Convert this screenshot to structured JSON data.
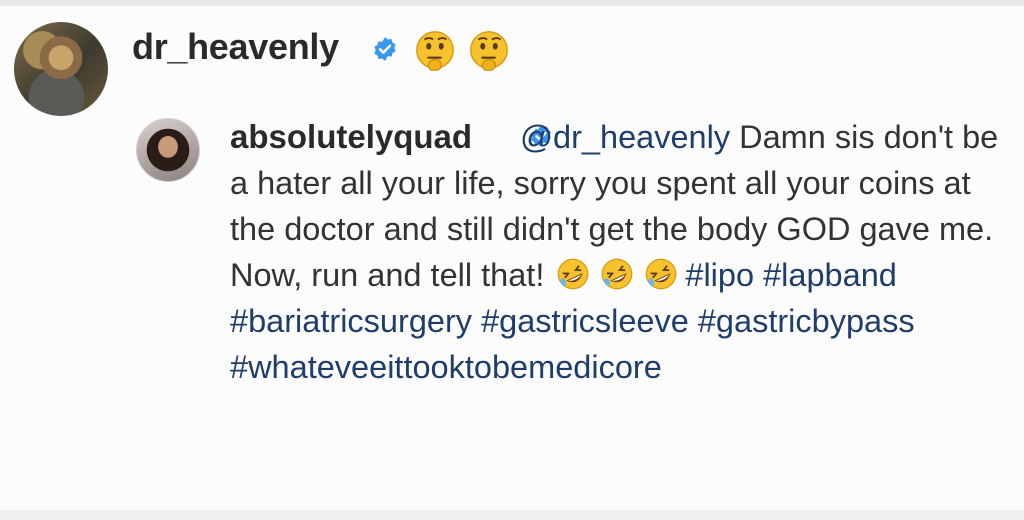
{
  "main_comment": {
    "username": "dr_heavenly",
    "verified": true,
    "emojis": [
      "thinking-face-emoji",
      "thinking-face-emoji"
    ]
  },
  "reply": {
    "username": "absolutelyquad",
    "verified": true,
    "mention": "@dr_heavenly",
    "text_part1": " Damn sis don't be a hater all your life, sorry you spent all your coins at the doctor and still didn't get the body GOD gave me. Now, run and tell that! ",
    "emojis": [
      "rolling-on-floor-laughing-emoji",
      "rolling-on-floor-laughing-emoji",
      "rolling-on-floor-laughing-emoji"
    ],
    "hashtags": [
      "#lipo",
      "#lapband",
      "#bariatricsurgery",
      "#gastricsleeve",
      "#gastricbypass",
      "#whateveeittooktobemedicore"
    ]
  },
  "colors": {
    "verified_blue": "#3897f0",
    "link_blue": "#1f3d6b",
    "text": "#333333",
    "emoji_yellow": "#f7c22b"
  }
}
